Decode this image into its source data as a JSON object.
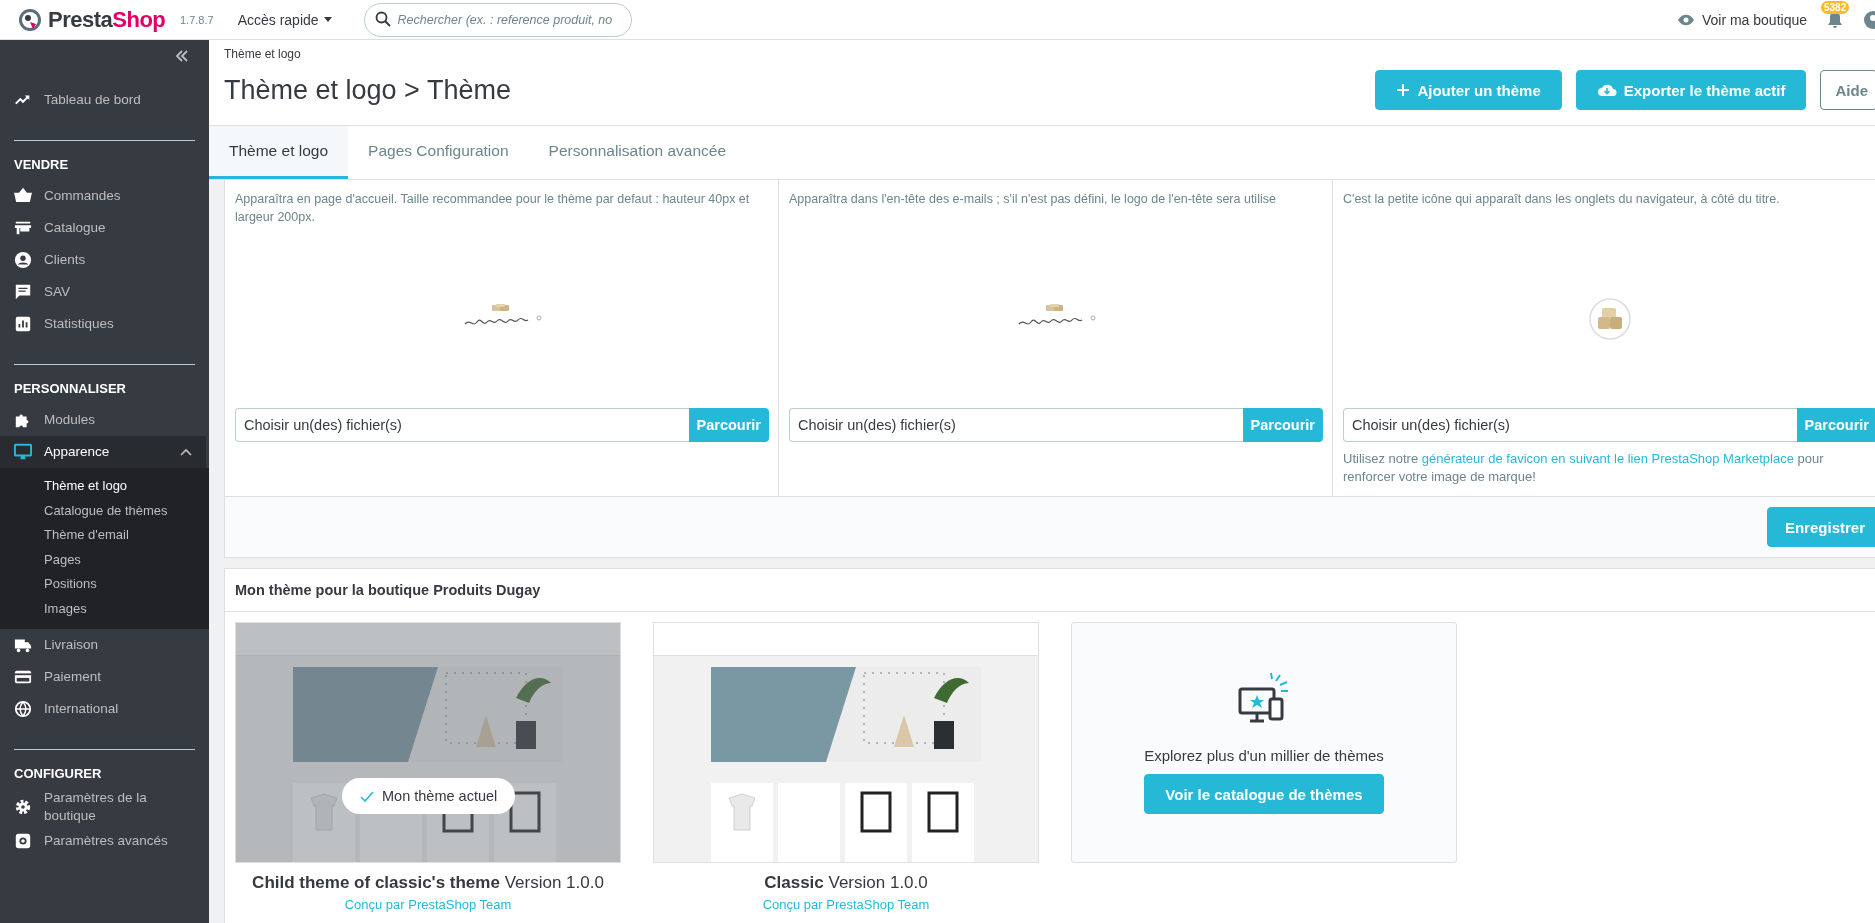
{
  "topbar": {
    "logo_part1": "Presta",
    "logo_part2": "Shop",
    "version": "1.7.8.7",
    "quick_access": "Accès rapide",
    "search": {
      "placeholder": "Rechercher (ex. : reference produit, no"
    },
    "view_shop": "Voir ma boutique",
    "notifications": "5382"
  },
  "sidebar": {
    "sections": [
      {
        "items": [
          {
            "label": "Tableau de bord",
            "selected": false,
            "expanded": false
          }
        ]
      },
      {
        "heading": "VENDRE",
        "items": [
          {
            "label": "Commandes",
            "selected": false,
            "expanded": false
          },
          {
            "label": "Catalogue",
            "selected": false,
            "expanded": false
          },
          {
            "label": "Clients",
            "selected": false,
            "expanded": false
          },
          {
            "label": "SAV",
            "selected": false,
            "expanded": false
          },
          {
            "label": "Statistiques",
            "selected": false,
            "expanded": false
          }
        ]
      },
      {
        "heading": "PERSONNALISER",
        "items": [
          {
            "label": "Modules",
            "selected": false,
            "expanded": false
          },
          {
            "label": "Apparence",
            "selected": true,
            "expanded": true,
            "children": [
              {
                "label": "Thème et logo",
                "selected": true
              },
              {
                "label": "Catalogue de thèmes",
                "selected": false
              },
              {
                "label": "Thème d'email",
                "selected": false
              },
              {
                "label": "Pages",
                "selected": false
              },
              {
                "label": "Positions",
                "selected": false
              },
              {
                "label": "Images",
                "selected": false
              }
            ]
          },
          {
            "label": "Livraison",
            "selected": false,
            "expanded": false
          },
          {
            "label": "Paiement",
            "selected": false,
            "expanded": false
          },
          {
            "label": "International",
            "selected": false,
            "expanded": false
          }
        ]
      },
      {
        "heading": "CONFIGURER",
        "items": [
          {
            "label": "Paramètres de la boutique",
            "selected": false,
            "expanded": false
          },
          {
            "label": "Paramètres avancés",
            "selected": false,
            "expanded": false
          }
        ]
      }
    ]
  },
  "header": {
    "breadcrumb": "Thème et logo",
    "title": "Thème et logo > Thème",
    "buttons": [
      {
        "label": "Ajouter un thème",
        "kind": "add"
      },
      {
        "label": "Exporter le thème actif",
        "kind": "export"
      },
      {
        "label": "Aide",
        "kind": "help"
      }
    ]
  },
  "tabs": [
    {
      "label": "Thème et logo",
      "selected": true
    },
    {
      "label": "Pages Configuration",
      "selected": false
    },
    {
      "label": "Personnalisation avancée",
      "selected": false
    }
  ],
  "uploads": [
    {
      "description": "Apparaîtra en page d'accueil. Taille recommandee pour le thème par defaut : hauteur 40px et largeur 200px.",
      "kind": "logo",
      "file_placeholder": "Choisir un(des) fichier(s)",
      "browse": "Parcourir"
    },
    {
      "description": "Apparaîtra dans l'en-tête des e-mails ; s'il n'est pas défini, le logo de l'en-tête sera utilise",
      "kind": "logo",
      "file_placeholder": "Choisir un(des) fichier(s)",
      "browse": "Parcourir"
    },
    {
      "description": "C'est la petite icône qui apparaît dans les onglets du navigateur, à côté du titre.",
      "kind": "favicon",
      "file_placeholder": "Choisir un(des) fichier(s)",
      "browse": "Parcourir",
      "hint_before": "Utilisez notre ",
      "hint_link": "générateur de favicon en suivant le lien PrestaShop Marketplace",
      "hint_after": " pour renforcer votre image de marque!"
    }
  ],
  "save_button": "Enregistrer",
  "themes_section": {
    "title": "Mon thème pour la boutique Produits Dugay",
    "themes": [
      {
        "name": "Child theme of classic's theme",
        "version": "Version 1.0.0",
        "author": "Conçu par PrestaShop Team",
        "current": true,
        "current_label": "Mon thème actuel"
      },
      {
        "name": "Classic",
        "version": "Version 1.0.0",
        "author": "Conçu par PrestaShop Team",
        "current": false
      }
    ],
    "explore": {
      "text": "Explorez plus d'un millier de thèmes",
      "button": "Voir le catalogue de thèmes"
    }
  }
}
